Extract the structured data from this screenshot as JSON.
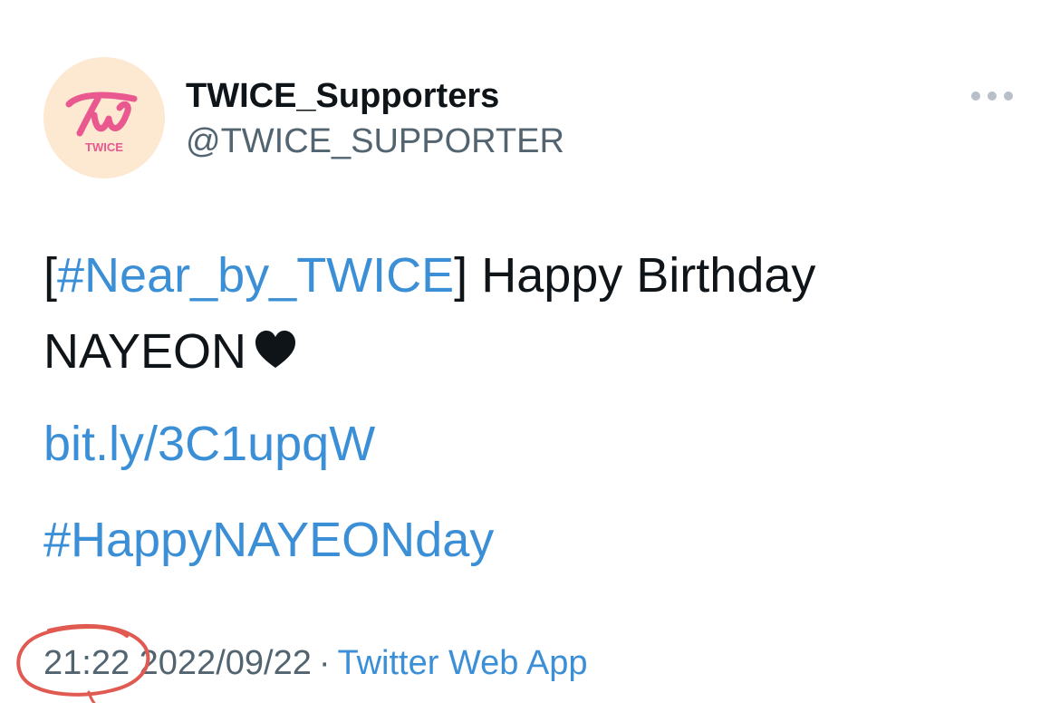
{
  "author": {
    "display_name": "TWICE_Supporters",
    "handle": "@TWICE_SUPPORTER",
    "avatar_text": "TWICE"
  },
  "tweet": {
    "bracket_open": "[",
    "hashtag_main": "#Near_by_TWICE",
    "bracket_close": "]",
    "text_rest": " Happy Birthday",
    "line2": "NAYEON",
    "url": "bit.ly/3C1upqW",
    "hashtag": "#HappyNAYEONday"
  },
  "meta": {
    "time": "21:22",
    "date": "2022/09/22",
    "separator": "·",
    "source": "Twitter Web App"
  },
  "colors": {
    "link": "#3b8fd6",
    "text": "#0f1419",
    "secondary": "#536471",
    "annotation": "#e05a52",
    "avatar_bg": "#fde8d2",
    "logo": "#e9588f"
  }
}
